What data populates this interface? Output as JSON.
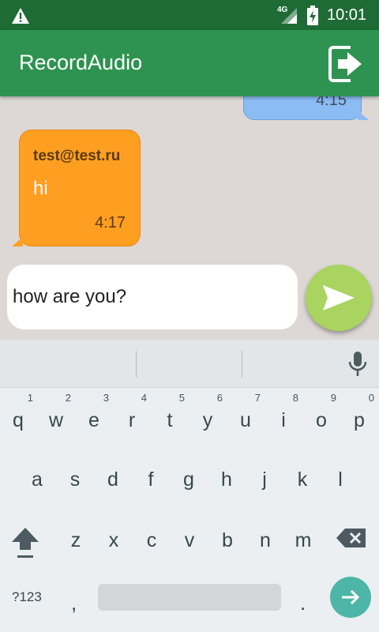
{
  "status_bar": {
    "network": "4G",
    "time": "10:01"
  },
  "app_bar": {
    "title": "RecordAudio"
  },
  "chat": {
    "outgoing_partial_time": "4:15",
    "incoming": {
      "sender": "test@test.ru",
      "text": "hi",
      "time": "4:17"
    }
  },
  "composer": {
    "value": "how are you?"
  },
  "keyboard": {
    "row1": [
      {
        "ch": "q",
        "hint": "1"
      },
      {
        "ch": "w",
        "hint": "2"
      },
      {
        "ch": "e",
        "hint": "3"
      },
      {
        "ch": "r",
        "hint": "4"
      },
      {
        "ch": "t",
        "hint": "5"
      },
      {
        "ch": "y",
        "hint": "6"
      },
      {
        "ch": "u",
        "hint": "7"
      },
      {
        "ch": "i",
        "hint": "8"
      },
      {
        "ch": "o",
        "hint": "9"
      },
      {
        "ch": "p",
        "hint": "0"
      }
    ],
    "row2": [
      "a",
      "s",
      "d",
      "f",
      "g",
      "h",
      "j",
      "k",
      "l"
    ],
    "row3": [
      "z",
      "x",
      "c",
      "v",
      "b",
      "n",
      "m"
    ],
    "symbols_label": "?123",
    "comma": ",",
    "period": "."
  },
  "colors": {
    "status_bar": "#1f6b35",
    "app_bar": "#2e9350",
    "outgoing_bubble": "#8bbcf3",
    "incoming_bubble": "#ff9f22",
    "send_button": "#a9d45f",
    "enter_key": "#4db6a8"
  }
}
